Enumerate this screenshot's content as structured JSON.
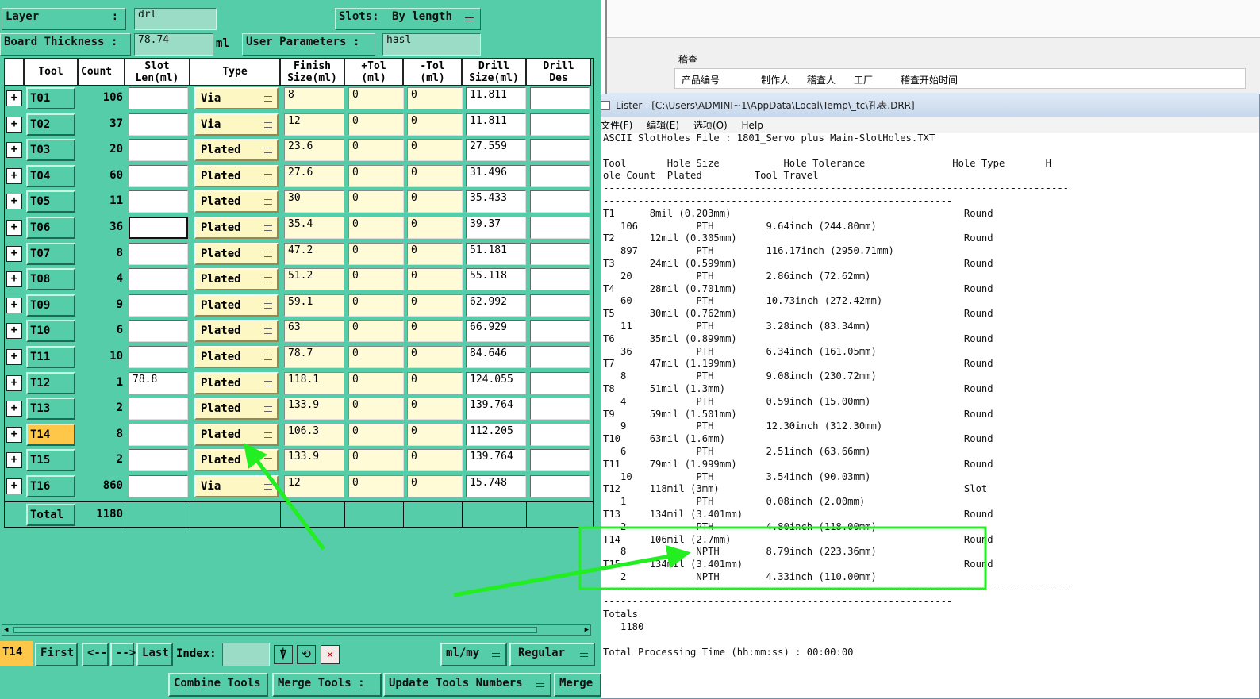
{
  "cam": {
    "layer_label": "Layer",
    "layer_colon": ":",
    "layer_value": "drl",
    "slots_label": "Slots:",
    "slots_value": "By length",
    "board_thickness_label": "Board Thickness :",
    "board_thickness_value": "78.74",
    "board_thickness_unit": "ml",
    "user_params_label": "User Parameters :",
    "user_params_value": "hasl",
    "headers": [
      "Tool",
      "Count",
      "Slot\nLen(ml)",
      "Type",
      "Finish\nSize(ml)",
      "+Tol\n(ml)",
      "-Tol\n(ml)",
      "Drill\nSize(ml)",
      "Drill\nDes"
    ],
    "rows": [
      {
        "tool": "T01",
        "count": "106",
        "slot": "",
        "type": "Via",
        "finish": "8",
        "ptol": "0",
        "mtol": "0",
        "drill": "11.811"
      },
      {
        "tool": "T02",
        "count": "37",
        "slot": "",
        "type": "Via",
        "finish": "12",
        "ptol": "0",
        "mtol": "0",
        "drill": "11.811"
      },
      {
        "tool": "T03",
        "count": "20",
        "slot": "",
        "type": "Plated",
        "finish": "23.6",
        "ptol": "0",
        "mtol": "0",
        "drill": "27.559"
      },
      {
        "tool": "T04",
        "count": "60",
        "slot": "",
        "type": "Plated",
        "finish": "27.6",
        "ptol": "0",
        "mtol": "0",
        "drill": "31.496"
      },
      {
        "tool": "T05",
        "count": "11",
        "slot": "",
        "type": "Plated",
        "finish": "30",
        "ptol": "0",
        "mtol": "0",
        "drill": "35.433"
      },
      {
        "tool": "T06",
        "count": "36",
        "slot": "",
        "type": "Plated",
        "finish": "35.4",
        "ptol": "0",
        "mtol": "0",
        "drill": "39.37"
      },
      {
        "tool": "T07",
        "count": "8",
        "slot": "",
        "type": "Plated",
        "finish": "47.2",
        "ptol": "0",
        "mtol": "0",
        "drill": "51.181"
      },
      {
        "tool": "T08",
        "count": "4",
        "slot": "",
        "type": "Plated",
        "finish": "51.2",
        "ptol": "0",
        "mtol": "0",
        "drill": "55.118"
      },
      {
        "tool": "T09",
        "count": "9",
        "slot": "",
        "type": "Plated",
        "finish": "59.1",
        "ptol": "0",
        "mtol": "0",
        "drill": "62.992"
      },
      {
        "tool": "T10",
        "count": "6",
        "slot": "",
        "type": "Plated",
        "finish": "63",
        "ptol": "0",
        "mtol": "0",
        "drill": "66.929"
      },
      {
        "tool": "T11",
        "count": "10",
        "slot": "",
        "type": "Plated",
        "finish": "78.7",
        "ptol": "0",
        "mtol": "0",
        "drill": "84.646"
      },
      {
        "tool": "T12",
        "count": "1",
        "slot": "78.8",
        "type": "Plated",
        "finish": "118.1",
        "ptol": "0",
        "mtol": "0",
        "drill": "124.055"
      },
      {
        "tool": "T13",
        "count": "2",
        "slot": "",
        "type": "Plated",
        "finish": "133.9",
        "ptol": "0",
        "mtol": "0",
        "drill": "139.764"
      },
      {
        "tool": "T14",
        "count": "8",
        "slot": "",
        "type": "Plated",
        "finish": "106.3",
        "ptol": "0",
        "mtol": "0",
        "drill": "112.205"
      },
      {
        "tool": "T15",
        "count": "2",
        "slot": "",
        "type": "Plated",
        "finish": "133.9",
        "ptol": "0",
        "mtol": "0",
        "drill": "139.764"
      },
      {
        "tool": "T16",
        "count": "860",
        "slot": "",
        "type": "Via",
        "finish": "12",
        "ptol": "0",
        "mtol": "0",
        "drill": "15.748"
      }
    ],
    "total_label": "Total",
    "total_count": "1180",
    "current_tool": "T14",
    "nav": {
      "first": "First",
      "prev": "<--",
      "next": "-->",
      "last": "Last",
      "index_label": "Index:"
    },
    "units_value": "ml/my",
    "mode_value": "Regular",
    "bottom_buttons": [
      "Combine Tools",
      "Merge Tools :",
      "Update Tools Numbers",
      "Merge"
    ]
  },
  "bg_window": {
    "section": "稽查",
    "columns": [
      "产品编号",
      "制作人",
      "稽查人",
      "工厂",
      "稽查开始时间"
    ]
  },
  "lister": {
    "title": "Lister - [C:\\Users\\ADMINI~1\\AppData\\Local\\Temp\\_tc\\孔表.DRR]",
    "menu": [
      "文件(F)",
      "编辑(E)",
      "选项(O)",
      "Help"
    ],
    "text": "ASCII SlotHoles File : 1801_Servo plus Main-SlotHoles.TXT\n\nTool       Hole Size           Hole Tolerance               Hole Type       H\nole Count  Plated         Tool Travel\n--------------------------------------------------------------------------------\n------------------------------------------------------------\nT1      8mil (0.203mm)                                        Round\n   106          PTH         9.64inch (244.80mm)\nT2      12mil (0.305mm)                                       Round\n   897          PTH         116.17inch (2950.71mm)\nT3      24mil (0.599mm)                                       Round\n   20           PTH         2.86inch (72.62mm)\nT4      28mil (0.701mm)                                       Round\n   60           PTH         10.73inch (272.42mm)\nT5      30mil (0.762mm)                                       Round\n   11           PTH         3.28inch (83.34mm)\nT6      35mil (0.899mm)                                       Round\n   36           PTH         6.34inch (161.05mm)\nT7      47mil (1.199mm)                                       Round\n   8            PTH         9.08inch (230.72mm)\nT8      51mil (1.3mm)                                         Round\n   4            PTH         0.59inch (15.00mm)\nT9      59mil (1.501mm)                                       Round\n   9            PTH         12.30inch (312.30mm)\nT10     63mil (1.6mm)                                         Round\n   6            PTH         2.51inch (63.66mm)\nT11     79mil (1.999mm)                                       Round\n   10           PTH         3.54inch (90.03mm)\nT12     118mil (3mm)                                          Slot\n   1            PTH         0.08inch (2.00mm)\nT13     134mil (3.401mm)                                      Round\n   2            PTH         4.80inch (118.00mm)\nT14     106mil (2.7mm)                                        Round\n   8            NPTH        8.79inch (223.36mm)\nT15     134mil (3.401mm)                                      Round\n   2            NPTH        4.33inch (110.00mm)\n--------------------------------------------------------------------------------\n------------------------------------------------------------\nTotals\n   1180\n\nTotal Processing Time (hh:mm:ss) : 00:00:00"
  },
  "colors": {
    "panel": "#55cda9",
    "highlight": "#ffc74a",
    "annotation": "#22ee22",
    "cell_yellow": "#fefbd6"
  }
}
